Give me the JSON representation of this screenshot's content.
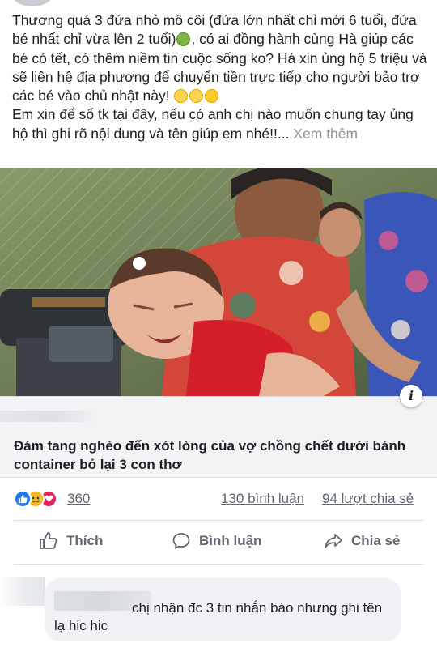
{
  "post": {
    "text_parts": [
      "Thương quá 3 đứa nhỏ mồ côi (đứa lớn nhất chỉ mới 6 tuổi, đứa bé nhất chỉ vừa lên 2 tuổi)",
      ", có ai đồng hành cùng Hà giúp các bé có tết, có thêm niềm tin cuộc sống ko? Hà xin ủng hộ 5 triệu và sẽ liên hệ địa phương để chuyển tiền trực tiếp cho người bảo trợ các bé vào chủ nhật này! ",
      "Em xin để số tk tại đây, nếu có anh chị nào muốn chung tay ủng hộ thì ghi rõ nội dung và tên giúp em nhé!!...",
      "Xem thêm"
    ],
    "emojis": [
      "nauseated-face",
      "anxious-face",
      "crying-face",
      "disappointed-face"
    ]
  },
  "link": {
    "info_label": "i",
    "title": "Đám tang nghèo đến xót lòng của vợ chồng chết dưới bánh container bỏ lại 3 con thơ"
  },
  "stats": {
    "reactions": [
      "like",
      "sad",
      "love"
    ],
    "reaction_count": "360",
    "comments": "130 bình luận",
    "shares": "94 lượt chia sẻ"
  },
  "actions": {
    "like": "Thích",
    "comment": "Bình luận",
    "share": "Chia sẻ"
  },
  "comment": {
    "text": "chị nhận đc 3 tin nhắn báo nhưng ghi tên lạ hic hic"
  },
  "colors": {
    "text": "#1c1e21",
    "muted": "#606770",
    "see_more": "#90949c",
    "like_blue": "#1877f2",
    "love_red": "#e0245e",
    "sad_yellow": "#f7b928",
    "card_bg": "#f2f3f5",
    "bubble_bg": "#f0f2f5"
  }
}
